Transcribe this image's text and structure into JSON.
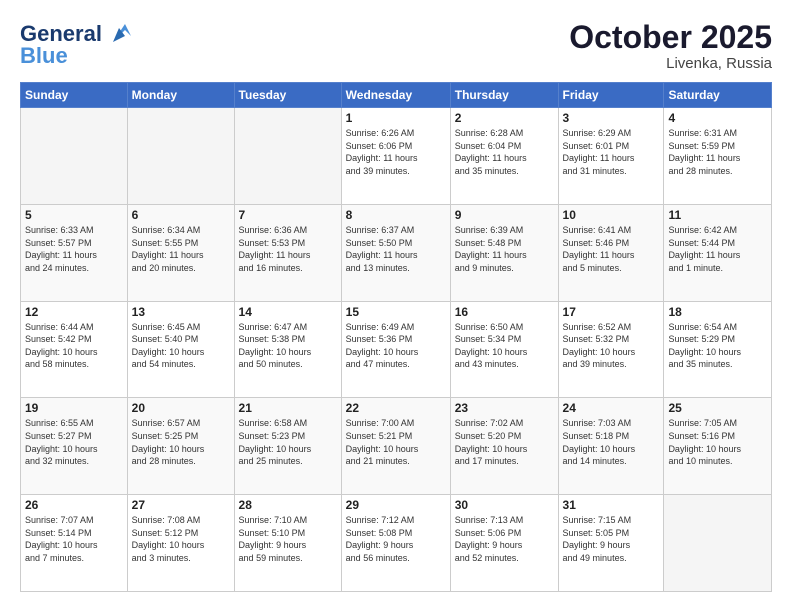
{
  "header": {
    "logo_line1": "General",
    "logo_line2": "Blue",
    "month": "October 2025",
    "location": "Livenka, Russia"
  },
  "weekdays": [
    "Sunday",
    "Monday",
    "Tuesday",
    "Wednesday",
    "Thursday",
    "Friday",
    "Saturday"
  ],
  "weeks": [
    [
      {
        "day": "",
        "info": ""
      },
      {
        "day": "",
        "info": ""
      },
      {
        "day": "",
        "info": ""
      },
      {
        "day": "1",
        "info": "Sunrise: 6:26 AM\nSunset: 6:06 PM\nDaylight: 11 hours\nand 39 minutes."
      },
      {
        "day": "2",
        "info": "Sunrise: 6:28 AM\nSunset: 6:04 PM\nDaylight: 11 hours\nand 35 minutes."
      },
      {
        "day": "3",
        "info": "Sunrise: 6:29 AM\nSunset: 6:01 PM\nDaylight: 11 hours\nand 31 minutes."
      },
      {
        "day": "4",
        "info": "Sunrise: 6:31 AM\nSunset: 5:59 PM\nDaylight: 11 hours\nand 28 minutes."
      }
    ],
    [
      {
        "day": "5",
        "info": "Sunrise: 6:33 AM\nSunset: 5:57 PM\nDaylight: 11 hours\nand 24 minutes."
      },
      {
        "day": "6",
        "info": "Sunrise: 6:34 AM\nSunset: 5:55 PM\nDaylight: 11 hours\nand 20 minutes."
      },
      {
        "day": "7",
        "info": "Sunrise: 6:36 AM\nSunset: 5:53 PM\nDaylight: 11 hours\nand 16 minutes."
      },
      {
        "day": "8",
        "info": "Sunrise: 6:37 AM\nSunset: 5:50 PM\nDaylight: 11 hours\nand 13 minutes."
      },
      {
        "day": "9",
        "info": "Sunrise: 6:39 AM\nSunset: 5:48 PM\nDaylight: 11 hours\nand 9 minutes."
      },
      {
        "day": "10",
        "info": "Sunrise: 6:41 AM\nSunset: 5:46 PM\nDaylight: 11 hours\nand 5 minutes."
      },
      {
        "day": "11",
        "info": "Sunrise: 6:42 AM\nSunset: 5:44 PM\nDaylight: 11 hours\nand 1 minute."
      }
    ],
    [
      {
        "day": "12",
        "info": "Sunrise: 6:44 AM\nSunset: 5:42 PM\nDaylight: 10 hours\nand 58 minutes."
      },
      {
        "day": "13",
        "info": "Sunrise: 6:45 AM\nSunset: 5:40 PM\nDaylight: 10 hours\nand 54 minutes."
      },
      {
        "day": "14",
        "info": "Sunrise: 6:47 AM\nSunset: 5:38 PM\nDaylight: 10 hours\nand 50 minutes."
      },
      {
        "day": "15",
        "info": "Sunrise: 6:49 AM\nSunset: 5:36 PM\nDaylight: 10 hours\nand 47 minutes."
      },
      {
        "day": "16",
        "info": "Sunrise: 6:50 AM\nSunset: 5:34 PM\nDaylight: 10 hours\nand 43 minutes."
      },
      {
        "day": "17",
        "info": "Sunrise: 6:52 AM\nSunset: 5:32 PM\nDaylight: 10 hours\nand 39 minutes."
      },
      {
        "day": "18",
        "info": "Sunrise: 6:54 AM\nSunset: 5:29 PM\nDaylight: 10 hours\nand 35 minutes."
      }
    ],
    [
      {
        "day": "19",
        "info": "Sunrise: 6:55 AM\nSunset: 5:27 PM\nDaylight: 10 hours\nand 32 minutes."
      },
      {
        "day": "20",
        "info": "Sunrise: 6:57 AM\nSunset: 5:25 PM\nDaylight: 10 hours\nand 28 minutes."
      },
      {
        "day": "21",
        "info": "Sunrise: 6:58 AM\nSunset: 5:23 PM\nDaylight: 10 hours\nand 25 minutes."
      },
      {
        "day": "22",
        "info": "Sunrise: 7:00 AM\nSunset: 5:21 PM\nDaylight: 10 hours\nand 21 minutes."
      },
      {
        "day": "23",
        "info": "Sunrise: 7:02 AM\nSunset: 5:20 PM\nDaylight: 10 hours\nand 17 minutes."
      },
      {
        "day": "24",
        "info": "Sunrise: 7:03 AM\nSunset: 5:18 PM\nDaylight: 10 hours\nand 14 minutes."
      },
      {
        "day": "25",
        "info": "Sunrise: 7:05 AM\nSunset: 5:16 PM\nDaylight: 10 hours\nand 10 minutes."
      }
    ],
    [
      {
        "day": "26",
        "info": "Sunrise: 7:07 AM\nSunset: 5:14 PM\nDaylight: 10 hours\nand 7 minutes."
      },
      {
        "day": "27",
        "info": "Sunrise: 7:08 AM\nSunset: 5:12 PM\nDaylight: 10 hours\nand 3 minutes."
      },
      {
        "day": "28",
        "info": "Sunrise: 7:10 AM\nSunset: 5:10 PM\nDaylight: 9 hours\nand 59 minutes."
      },
      {
        "day": "29",
        "info": "Sunrise: 7:12 AM\nSunset: 5:08 PM\nDaylight: 9 hours\nand 56 minutes."
      },
      {
        "day": "30",
        "info": "Sunrise: 7:13 AM\nSunset: 5:06 PM\nDaylight: 9 hours\nand 52 minutes."
      },
      {
        "day": "31",
        "info": "Sunrise: 7:15 AM\nSunset: 5:05 PM\nDaylight: 9 hours\nand 49 minutes."
      },
      {
        "day": "",
        "info": ""
      }
    ]
  ]
}
